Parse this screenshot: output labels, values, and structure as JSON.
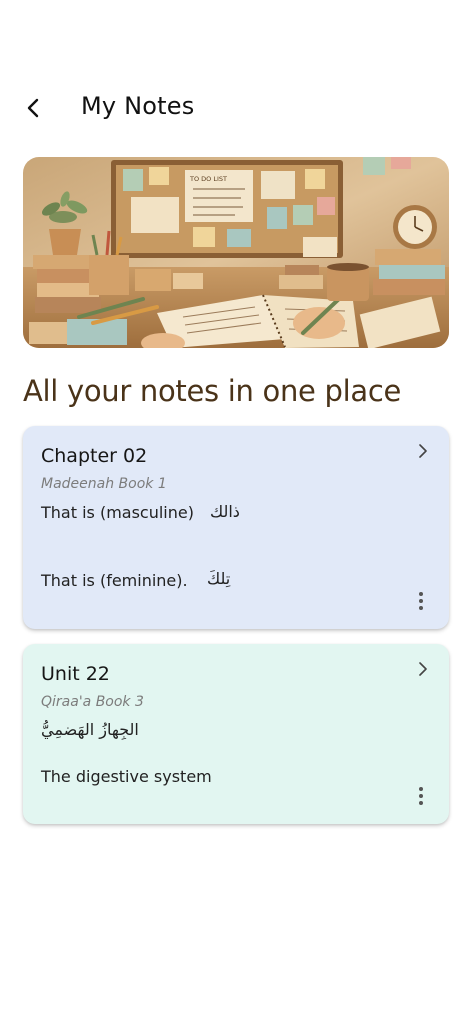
{
  "header": {
    "back_icon": "chevron-left-icon",
    "title": "My Notes"
  },
  "hero": {
    "image_label": "TO DO LIST"
  },
  "section": {
    "heading": "All your notes in one place"
  },
  "notes": [
    {
      "title": "Chapter 02",
      "subtitle": "Madeenah Book 1",
      "lines": [
        {
          "english": "That is (masculine)",
          "arabic": "ذالك"
        },
        {
          "english": "That is (feminine).",
          "arabic": "تِلكَ"
        }
      ],
      "background": "#e1e9f8"
    },
    {
      "title": "Unit 22",
      "subtitle": "Qiraa'a Book 3",
      "arabic": "الجِهازُ الهَضمِيُّ",
      "english": "The digestive system",
      "background": "#e2f6f1"
    }
  ],
  "colors": {
    "heading": "#4a3319",
    "card_blue": "#e1e9f8",
    "card_mint": "#e2f6f1"
  }
}
